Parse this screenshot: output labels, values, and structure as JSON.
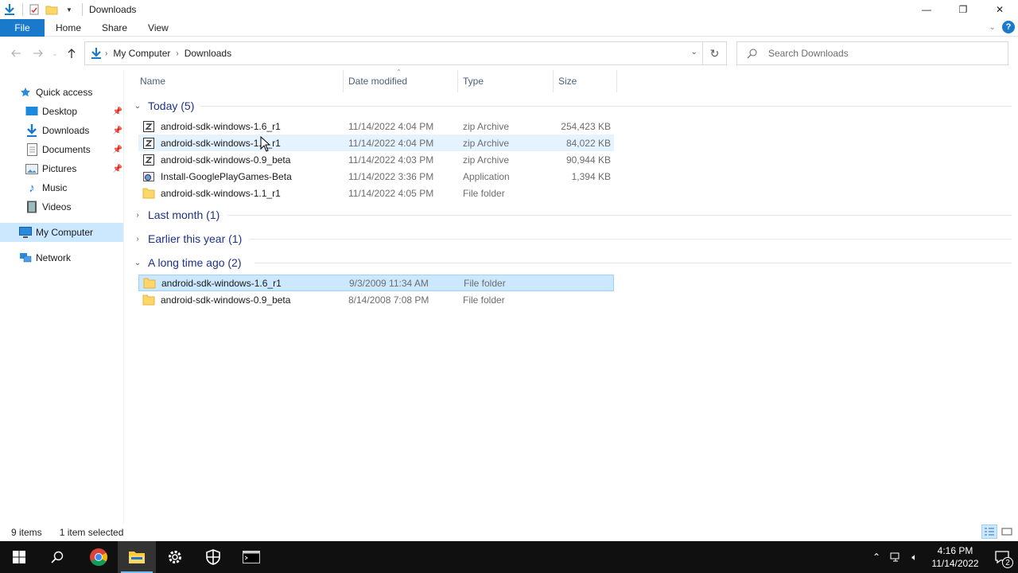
{
  "window": {
    "title": "Downloads",
    "controls": {
      "minimize": "—",
      "restore": "❐",
      "close": "✕"
    }
  },
  "ribbon": {
    "tabs": [
      "File",
      "Home",
      "Share",
      "View"
    ],
    "help": "?"
  },
  "address": {
    "crumbs": [
      "My Computer",
      "Downloads"
    ],
    "search_placeholder": "Search Downloads"
  },
  "nav": {
    "quick_access": "Quick access",
    "items": [
      {
        "label": "Desktop",
        "icon": "desktop-icon",
        "pinned": true
      },
      {
        "label": "Downloads",
        "icon": "downloads-icon",
        "pinned": true
      },
      {
        "label": "Documents",
        "icon": "documents-icon",
        "pinned": true
      },
      {
        "label": "Pictures",
        "icon": "pictures-icon",
        "pinned": true
      },
      {
        "label": "Music",
        "icon": "music-icon",
        "pinned": false
      },
      {
        "label": "Videos",
        "icon": "videos-icon",
        "pinned": false
      }
    ],
    "my_computer": "My Computer",
    "network": "Network"
  },
  "columns": {
    "name": "Name",
    "date": "Date modified",
    "type": "Type",
    "size": "Size"
  },
  "groups": [
    {
      "label": "Today (5)",
      "expanded": true,
      "rows": [
        {
          "name": "android-sdk-windows-1.6_r1",
          "date": "11/14/2022 4:04 PM",
          "type": "zip Archive",
          "size": "254,423 KB",
          "icon": "zip-icon"
        },
        {
          "name": "android-sdk-windows-1.1_r1",
          "date": "11/14/2022 4:04 PM",
          "type": "zip Archive",
          "size": "84,022 KB",
          "icon": "zip-icon"
        },
        {
          "name": "android-sdk-windows-0.9_beta",
          "date": "11/14/2022 4:03 PM",
          "type": "zip Archive",
          "size": "90,944 KB",
          "icon": "zip-icon"
        },
        {
          "name": "Install-GooglePlayGames-Beta",
          "date": "11/14/2022 3:36 PM",
          "type": "Application",
          "size": "1,394 KB",
          "icon": "application-icon"
        },
        {
          "name": "android-sdk-windows-1.1_r1",
          "date": "11/14/2022 4:05 PM",
          "type": "File folder",
          "size": "",
          "icon": "folder-icon"
        }
      ]
    },
    {
      "label": "Last month (1)",
      "expanded": false,
      "rows": []
    },
    {
      "label": "Earlier this year (1)",
      "expanded": false,
      "rows": []
    },
    {
      "label": "A long time ago (2)",
      "expanded": true,
      "rows": [
        {
          "name": "android-sdk-windows-1.6_r1",
          "date": "9/3/2009 11:34 AM",
          "type": "File folder",
          "size": "",
          "icon": "folder-icon"
        },
        {
          "name": "android-sdk-windows-0.9_beta",
          "date": "8/14/2008 7:08 PM",
          "type": "File folder",
          "size": "",
          "icon": "folder-icon"
        }
      ]
    }
  ],
  "status": {
    "count": "9 items",
    "selection": "1 item selected"
  },
  "taskbar": {
    "clock_time": "4:16 PM",
    "clock_date": "11/14/2022",
    "notifications": "2"
  },
  "colors": {
    "accent": "#1979ca",
    "selected": "#cce8ff",
    "hover": "#e5f3ff",
    "group_header": "#1e3287"
  }
}
